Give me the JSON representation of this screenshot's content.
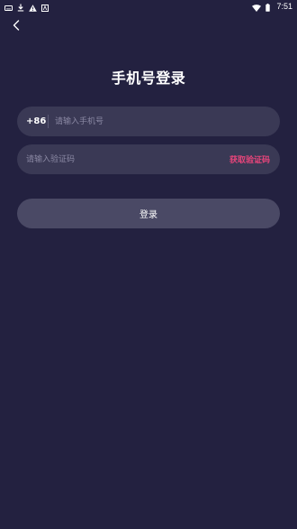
{
  "status_bar": {
    "time": "7:51",
    "left_icons": [
      "keyboard-icon",
      "download-icon",
      "warning-icon",
      "translate-icon"
    ],
    "right_icons": [
      "wifi-icon",
      "battery-icon"
    ]
  },
  "header": {
    "back_icon": "chevron-left-icon"
  },
  "page": {
    "title": "手机号登录"
  },
  "phone_field": {
    "country_code": "+86",
    "value": "",
    "placeholder": "请输入手机号"
  },
  "code_field": {
    "value": "",
    "placeholder": "请输入验证码",
    "get_code_label": "获取验证码"
  },
  "login_button": {
    "label": "登录"
  },
  "colors": {
    "background": "#232140",
    "field_bg": "#3a3955",
    "button_bg": "#4a4965",
    "accent": "#e8457b",
    "placeholder": "#8a88a3"
  }
}
